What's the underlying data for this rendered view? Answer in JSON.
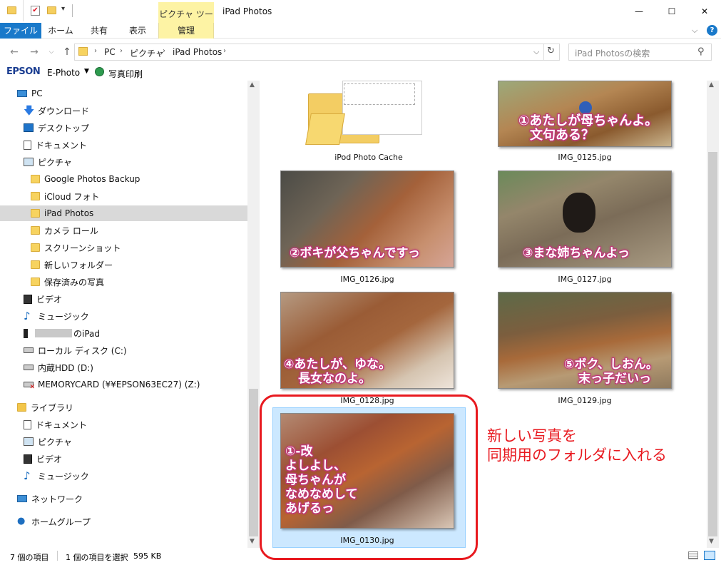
{
  "window": {
    "title": "iPad Photos",
    "tool_tab": "ピクチャ ツール",
    "minimize": "—",
    "maximize": "☐",
    "close": "✕"
  },
  "ribbon": {
    "tabs": [
      "ファイル",
      "ホーム",
      "共有",
      "表示",
      "管理"
    ],
    "help": "?"
  },
  "address": {
    "crumbs": [
      "PC",
      "ピクチャ",
      "iPad Photos"
    ],
    "search_placeholder": "iPad Photosの検索"
  },
  "epson": {
    "brand": "EPSON",
    "app": "E-Photo",
    "print_label": "写真印刷"
  },
  "sidebar": {
    "items": [
      {
        "label": "PC",
        "icon": "pc-icon"
      },
      {
        "label": "ダウンロード",
        "icon": "download-icon"
      },
      {
        "label": "デスクトップ",
        "icon": "desktop-icon"
      },
      {
        "label": "ドキュメント",
        "icon": "document-icon"
      },
      {
        "label": "ピクチャ",
        "icon": "pictures-icon"
      },
      {
        "label": "Google Photos Backup",
        "icon": "folder-icon"
      },
      {
        "label": "iCloud フォト",
        "icon": "folder-icon"
      },
      {
        "label": "iPad Photos",
        "icon": "folder-icon",
        "selected": true
      },
      {
        "label": "カメラ ロール",
        "icon": "folder-icon"
      },
      {
        "label": "スクリーンショット",
        "icon": "folder-icon"
      },
      {
        "label": "新しいフォルダー",
        "icon": "folder-icon"
      },
      {
        "label": "保存済みの写真",
        "icon": "folder-icon"
      },
      {
        "label": "ビデオ",
        "icon": "video-icon"
      },
      {
        "label": "ミュージック",
        "icon": "music-icon"
      },
      {
        "label": "のiPad",
        "icon": "ipad-icon"
      },
      {
        "label": "ローカル ディスク (C:)",
        "icon": "drive-icon"
      },
      {
        "label": "内蔵HDD (D:)",
        "icon": "drive-icon"
      },
      {
        "label": "MEMORYCARD (¥¥EPSON63EC27) (Z:)",
        "icon": "network-drive-icon"
      },
      {
        "label": "ライブラリ",
        "icon": "library-icon"
      },
      {
        "label": "ドキュメント",
        "icon": "document-icon"
      },
      {
        "label": "ピクチャ",
        "icon": "pictures-icon"
      },
      {
        "label": "ビデオ",
        "icon": "video-icon"
      },
      {
        "label": "ミュージック",
        "icon": "music-icon"
      },
      {
        "label": "ネットワーク",
        "icon": "network-icon"
      },
      {
        "label": "ホームグループ",
        "icon": "homegroup-icon"
      }
    ]
  },
  "files": [
    {
      "name": "iPod Photo Cache",
      "type": "folder"
    },
    {
      "name": "IMG_0125.jpg",
      "caption": [
        "①あたしが母ちゃんよ。",
        "文句ある？"
      ]
    },
    {
      "name": "IMG_0126.jpg",
      "caption": [
        "②ボキが父ちゃんですっ"
      ]
    },
    {
      "name": "IMG_0127.jpg",
      "caption": [
        "③まな姉ちゃんよっ"
      ]
    },
    {
      "name": "IMG_0128.jpg",
      "caption": [
        "④あたしが、ゆな。",
        "長女なのよ。"
      ]
    },
    {
      "name": "IMG_0129.jpg",
      "caption": [
        "⑤ボク、しおん。",
        "末っ子だいっ"
      ]
    },
    {
      "name": "IMG_0130.jpg",
      "caption": [
        "①-改",
        "よしよし、",
        "母ちゃんが",
        "なめなめして",
        "あげるっ"
      ],
      "selected": true
    }
  ],
  "status": {
    "count": "7 個の項目",
    "selection": "1 個の項目を選択",
    "size": "595 KB"
  },
  "annotation": {
    "lines": [
      "新しい写真を",
      "同期用のフォルダに入れる"
    ],
    "color": "#e8191f"
  }
}
